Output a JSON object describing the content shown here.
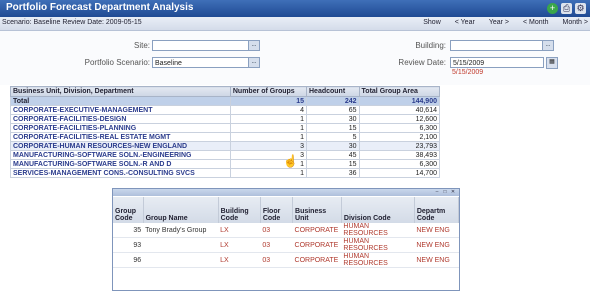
{
  "app": {
    "title": "Portfolio Forecast Department Analysis",
    "scenario_line": "Scenario: Baseline Review Date: 2009-05-15"
  },
  "nav": {
    "show": "Show",
    "prev_year": "< Year",
    "next_year": "Year >",
    "prev_month": "< Month",
    "next_month": "Month >"
  },
  "filters": {
    "site_label": "Site:",
    "site_value": "",
    "scenario_label": "Portfolio Scenario:",
    "scenario_value": "Baseline",
    "building_label": "Building:",
    "building_value": "",
    "review_label": "Review Date:",
    "review_value": "5/15/2009",
    "review_echo": "5/15/2009",
    "lookup_btn": "..."
  },
  "main_table": {
    "headers": [
      "Business Unit, Division, Department",
      "Number of Groups",
      "Headcount",
      "Total Group Area"
    ],
    "total": [
      "Total",
      "15",
      "242",
      "144,900"
    ],
    "rows": [
      [
        "CORPORATE-EXECUTIVE-MANAGEMENT",
        "4",
        "65",
        "40,614"
      ],
      [
        "CORPORATE-FACILITIES-DESIGN",
        "1",
        "30",
        "12,600"
      ],
      [
        "CORPORATE-FACILITIES-PLANNING",
        "1",
        "15",
        "6,300"
      ],
      [
        "CORPORATE-FACILITIES-REAL ESTATE MGMT",
        "1",
        "5",
        "2,100"
      ],
      [
        "CORPORATE-HUMAN RESOURCES-NEW ENGLAND",
        "3",
        "30",
        "23,793"
      ],
      [
        "MANUFACTURING-SOFTWARE SOLN.-ENGINEERING",
        "3",
        "45",
        "38,493"
      ],
      [
        "MANUFACTURING-SOFTWARE SOLN.-R AND D",
        "1",
        "15",
        "6,300"
      ],
      [
        "SERVICES-MANAGEMENT CONS.-CONSULTING SVCS",
        "1",
        "36",
        "14,700"
      ]
    ]
  },
  "popup": {
    "headers": [
      "Group Code",
      "Group Name",
      "Building Code",
      "Floor Code",
      "Business Unit",
      "Division Code",
      "Departm Code"
    ],
    "rows": [
      [
        "35",
        "Tony Brady's Group",
        "LX",
        "03",
        "CORPORATE",
        "HUMAN RESOURCES",
        "NEW ENG"
      ],
      [
        "93",
        "",
        "LX",
        "03",
        "CORPORATE",
        "HUMAN RESOURCES",
        "NEW ENG"
      ],
      [
        "96",
        "",
        "LX",
        "03",
        "CORPORATE",
        "HUMAN RESOURCES",
        "NEW ENG"
      ]
    ]
  }
}
